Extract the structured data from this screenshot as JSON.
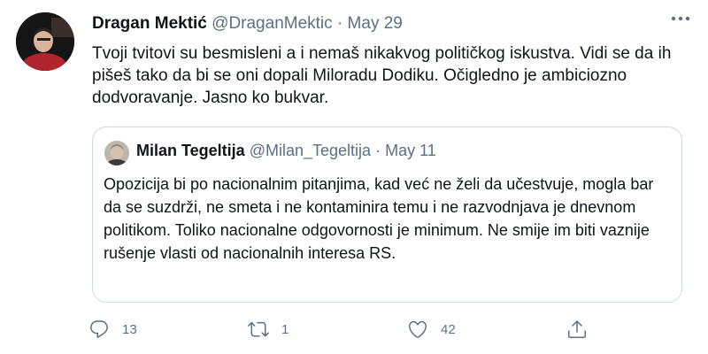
{
  "tweet": {
    "author_name": "Dragan Mektić",
    "author_handle": "@DraganMektic",
    "separator": "·",
    "date": "May 29",
    "text": "Tvoji tvitovi su besmisleni a i nemaš nikakvog političkog iskustva. Vidi se da ih pišeš tako da bi se oni dopali Miloradu Dodiku. Očigledno je ambiciozno dodvoravanje. Jasno ko bukvar."
  },
  "quoted_tweet": {
    "author_name": "Milan Tegeltija",
    "author_handle": "@Milan_Tegeltija",
    "separator": "·",
    "date": "May 11",
    "text": "Opozicija bi po nacionalnim pitanjima, kad već ne želi da učestvuje, mogla bar da se suzdrži, ne smeta i ne kontaminira temu i ne razvodnjava je dnevnom politikom. Toliko nacionalne odgovornosti je minimum.  Ne smije im biti vaznije rušenje vlasti od nacionalnih interesa RS."
  },
  "actions": {
    "reply_count": "13",
    "retweet_count": "1",
    "like_count": "42"
  },
  "icons": {
    "more": "more-icon",
    "reply": "reply-icon",
    "retweet": "retweet-icon",
    "like": "heart-icon",
    "share": "share-icon"
  },
  "colors": {
    "text": "#0f1419",
    "muted": "#5b7083",
    "border": "#cfd9de"
  }
}
